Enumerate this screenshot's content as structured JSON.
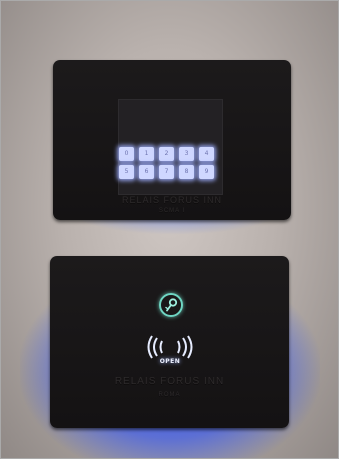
{
  "keypad": {
    "keys": [
      "0",
      "1",
      "2",
      "3",
      "4",
      "5",
      "6",
      "7",
      "8",
      "9"
    ],
    "engraved_brand": "RELAIS FORUS INN",
    "engraved_sub": "SCMA I"
  },
  "reader": {
    "open_label": "OPEN",
    "engraved_brand": "RELAIS FORUS INN",
    "engraved_sub": "ROMA"
  },
  "colors": {
    "glow_blue": "#2a50ff",
    "key_light": "#cfd7ff",
    "badge_teal": "#6fd6c3",
    "panel": "#1a1819",
    "wall": "#c2bab6"
  },
  "icons": [
    "key-icon",
    "nfc-waves-icon"
  ]
}
